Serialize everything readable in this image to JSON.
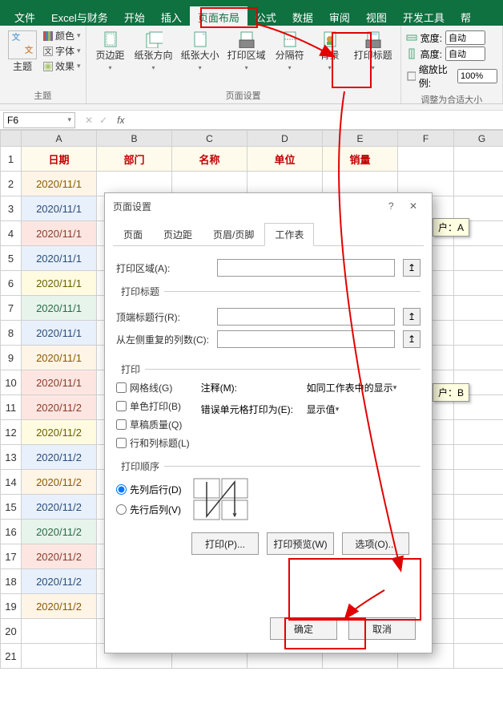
{
  "tabs": [
    "文件",
    "Excel与财务",
    "开始",
    "插入",
    "页面布局",
    "公式",
    "数据",
    "审阅",
    "视图",
    "开发工具",
    "帮"
  ],
  "active_tab": 4,
  "ribbon": {
    "theme": {
      "label": "主题",
      "opts": [
        "颜色",
        "字体",
        "效果"
      ],
      "group": "主题"
    },
    "page_setup": {
      "btns": [
        "页边距",
        "纸张方向",
        "纸张大小",
        "打印区域",
        "分隔符",
        "背景",
        "打印标题"
      ],
      "group": "页面设置"
    },
    "scale": {
      "width_label": "宽度:",
      "height_label": "高度:",
      "scale_label": "缩放比例:",
      "auto": "自动",
      "pct": "100%",
      "group": "调整为合适大小"
    }
  },
  "formula_bar": {
    "cell": "F6",
    "fx": "fx"
  },
  "col_letters": [
    "A",
    "B",
    "C",
    "D",
    "E",
    "F",
    "G"
  ],
  "headers": [
    "日期",
    "部门",
    "名称",
    "单位",
    "销量"
  ],
  "rows": [
    {
      "d": "2020/11/1",
      "cls": "c1"
    },
    {
      "d": "2020/11/1",
      "cls": "c2"
    },
    {
      "d": "2020/11/1",
      "cls": "c3"
    },
    {
      "d": "2020/11/1",
      "cls": "c2"
    },
    {
      "d": "2020/11/1",
      "cls": "c4"
    },
    {
      "d": "2020/11/1",
      "cls": "c5"
    },
    {
      "d": "2020/11/1",
      "cls": "c2"
    },
    {
      "d": "2020/11/1",
      "cls": "c1"
    },
    {
      "d": "2020/11/1",
      "cls": "c3"
    },
    {
      "d": "2020/11/2",
      "cls": "c3"
    },
    {
      "d": "2020/11/2",
      "cls": "c4"
    },
    {
      "d": "2020/11/2",
      "cls": "c2"
    },
    {
      "d": "2020/11/2",
      "cls": "c1"
    },
    {
      "d": "2020/11/2",
      "cls": "c2"
    },
    {
      "d": "2020/11/2",
      "cls": "c5"
    },
    {
      "d": "2020/11/2",
      "cls": "c3"
    },
    {
      "d": "2020/11/2",
      "cls": "c2"
    },
    {
      "d": "2020/11/2",
      "cls": "c1"
    }
  ],
  "tooltips": {
    "a": "户：A",
    "b": "户：B"
  },
  "dialog": {
    "title": "页面设置",
    "tabs": [
      "页面",
      "页边距",
      "页眉/页脚",
      "工作表"
    ],
    "active_tab": 3,
    "print_area_label": "打印区域(A):",
    "titles_legend": "打印标题",
    "top_rows_label": "顶端标题行(R):",
    "left_cols_label": "从左侧重复的列数(C):",
    "print_legend": "打印",
    "chk": [
      "网格线(G)",
      "单色打印(B)",
      "草稿质量(Q)",
      "行和列标题(L)"
    ],
    "comment_label": "注释(M):",
    "comment_value": "如同工作表中的显示",
    "error_label": "错误单元格打印为(E):",
    "error_value": "显示值",
    "order_legend": "打印顺序",
    "radios": [
      "先列后行(D)",
      "先行后列(V)"
    ],
    "btns": [
      "打印(P)...",
      "打印预览(W)",
      "选项(O)..."
    ],
    "ok": "确定",
    "cancel": "取消"
  }
}
